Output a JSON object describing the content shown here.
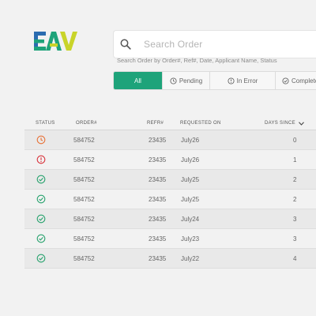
{
  "brand": {
    "logo_text": "EAV"
  },
  "search": {
    "placeholder": "Search Order",
    "value": "",
    "hint": "Search Order by Order#, Ref#,  Date, Applicant Name, Status",
    "icon": "search-icon"
  },
  "filters": [
    {
      "label": "All",
      "icon": "",
      "active": true
    },
    {
      "label": "Pending",
      "icon": "clock-icon",
      "active": false
    },
    {
      "label": "In Error",
      "icon": "alert-icon",
      "active": false
    },
    {
      "label": "Complete",
      "icon": "check-circle-icon",
      "active": false
    }
  ],
  "table": {
    "headers": {
      "status": "STATUS",
      "order": "ORDER#",
      "ref": "REFR#",
      "requested": "REQUESTED ON",
      "days": "DAYS SINCE"
    },
    "sort_icon": "chevron-down-icon",
    "rows": [
      {
        "status": "pending",
        "order": "584752",
        "ref": "23435",
        "requested": "July26",
        "days": "0"
      },
      {
        "status": "error",
        "order": "584752",
        "ref": "23435",
        "requested": "July26",
        "days": "1"
      },
      {
        "status": "complete",
        "order": "584752",
        "ref": "23435",
        "requested": "July25",
        "days": "2"
      },
      {
        "status": "complete",
        "order": "584752",
        "ref": "23435",
        "requested": "July25",
        "days": "2"
      },
      {
        "status": "complete",
        "order": "584752",
        "ref": "23435",
        "requested": "July24",
        "days": "3"
      },
      {
        "status": "complete",
        "order": "584752",
        "ref": "23435",
        "requested": "July23",
        "days": "3"
      },
      {
        "status": "complete",
        "order": "584752",
        "ref": "23435",
        "requested": "July22",
        "days": "4"
      }
    ]
  },
  "colors": {
    "accent": "#1ea37a",
    "pending": "#e8743b",
    "error": "#d9363e",
    "complete": "#2aa36f",
    "logo_blue": "#2b6cb0",
    "logo_green": "#1ea37a",
    "logo_yellow": "#c9d42a"
  }
}
